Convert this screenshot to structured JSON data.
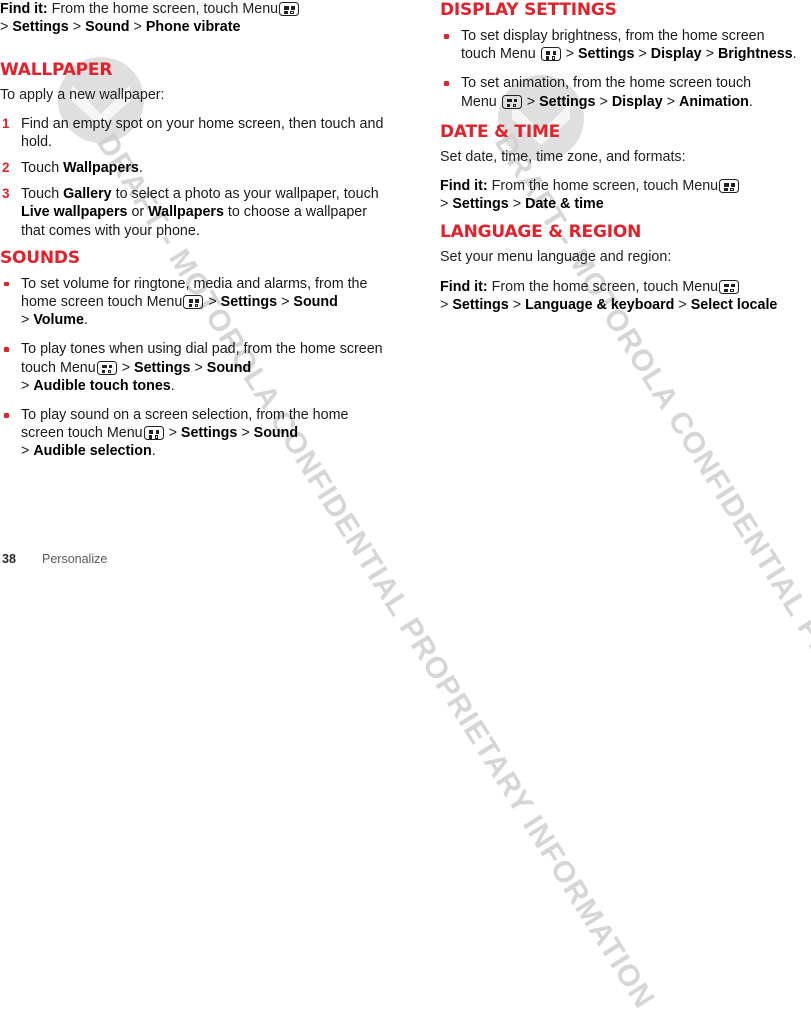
{
  "page": {
    "number": "38",
    "section_label": "Personalize",
    "accent_color": "#e2212b",
    "watermark": "DRAFT - MOTOROLA CONFIDENTIAL PROPRIETARY INFORMATION",
    "logo_icon": "motorola-batwing-logo",
    "menu_icon_name": "menu-grid-icon"
  },
  "left_column": {
    "findit_top": {
      "label": "Find it:",
      "text_before_icon": "From the home screen, touch Menu",
      "path_line": "> Settings > Sound > Phone vibrate",
      "crumbs": [
        "Settings",
        "Sound",
        "Phone vibrate"
      ]
    },
    "wallpaper": {
      "heading": "Wallpaper",
      "intro": "To apply a new wallpaper:",
      "steps": [
        {
          "num": "1",
          "text": "Find an empty spot on your home screen, then touch and hold."
        },
        {
          "num": "2",
          "text": "Touch Wallpapers."
        },
        {
          "num": "3",
          "text": "Touch Gallery to select a photo as your wallpaper, touch Live wallpapers or Wallpapers to choose a wallpaper that comes with your phone."
        }
      ],
      "step2_lead": "Touch",
      "step2_bold": "Wallpapers",
      "step2_tail": ".",
      "step3_lead": "Touch",
      "step3_bold1": "Gallery",
      "step3_mid1": "to select a photo as your wallpaper, touch",
      "step3_bold2": "Live wallpapers",
      "step3_mid2": "or",
      "step3_bold3": "Wallpapers",
      "step3_tail": "to choose a wallpaper that comes with your phone."
    },
    "sounds": {
      "heading": "Sounds",
      "bullets": [
        {
          "lead": "To set volume for ringtone, media and alarms, from the home screen touch Menu",
          "crumbs": [
            "Settings",
            "Sound",
            "Volume"
          ],
          "tail": "."
        },
        {
          "lead": "To play tones when using dial pad, from the home screen touch Menu",
          "crumbs": [
            "Settings",
            "Sound",
            "Audible touch tones"
          ],
          "tail": "."
        },
        {
          "lead": "To play sound on a screen selection, from the home screen touch Menu",
          "crumbs": [
            "Settings",
            "Sound",
            "Audible selection"
          ],
          "tail": "."
        }
      ]
    }
  },
  "right_column": {
    "display_settings": {
      "heading": "Display settings",
      "bullets": [
        {
          "lead": "To set display brightness, from the home screen touch Menu",
          "crumbs": [
            "Settings",
            "Display",
            "Brightness"
          ],
          "tail": "."
        },
        {
          "lead": "To set animation, from the home screen touch Menu",
          "crumbs": [
            "Settings",
            "Display",
            "Animation"
          ],
          "tail": "."
        }
      ]
    },
    "date_time": {
      "heading": "Date & time",
      "intro": "Set date, time, time zone, and formats:",
      "findit_label": "Find it:",
      "findit_text": "From the home screen, touch Menu",
      "path_line": "> Settings > Date & time",
      "crumbs": [
        "Settings",
        "Date & time"
      ]
    },
    "language_region": {
      "heading": "Language & region",
      "intro": "Set your menu language and region:",
      "findit_label": "Find it:",
      "findit_text": "From the home screen, touch Menu",
      "path_line": "> Settings > Language & keyboard > Select locale",
      "crumbs": [
        "Settings",
        "Language & keyboard",
        "Select locale"
      ]
    }
  }
}
